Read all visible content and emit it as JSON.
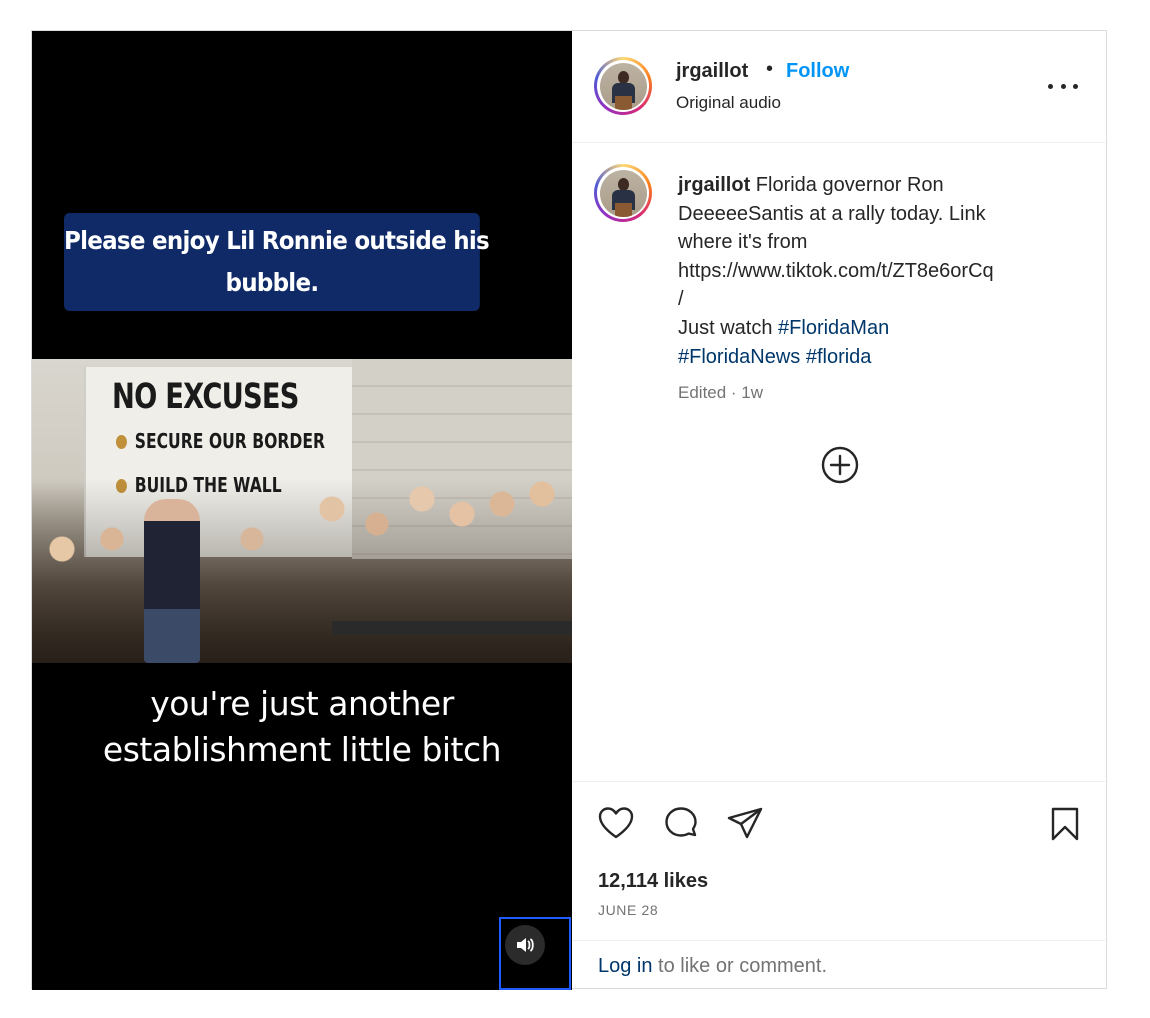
{
  "video": {
    "caption_top_lines": [
      "Please enjoy Lil Ronnie outside his",
      "bubble."
    ],
    "banner_heading": "NO EXCUSES",
    "banner_lines": [
      "SECURE OUR BORDER",
      "BUILD THE WALL"
    ],
    "caption_bottom_lines": [
      "you're just another",
      "establishment little bitch"
    ]
  },
  "header": {
    "username": "jrgaillot",
    "separator": "•",
    "follow_label": "Follow",
    "audio_label": "Original audio"
  },
  "caption": {
    "username": "jrgaillot",
    "lines": [
      "Florida governor Ron",
      "DeeeeeSantis at a rally today. Link",
      "where it's from",
      "https://www.tiktok.com/t/ZT8e6orCq",
      "/"
    ],
    "last_line_prefix": "Just watch ",
    "hashtags": [
      "#FloridaMan",
      "#FloridaNews",
      "#florida"
    ],
    "meta": "Edited · 1w"
  },
  "stats": {
    "likes": "12,114 likes",
    "date": "JUNE 28"
  },
  "footer": {
    "login_link": "Log in",
    "login_rest": " to like or comment."
  },
  "icons": {
    "like": "heart-icon",
    "comment": "comment-icon",
    "share": "share-icon",
    "save": "bookmark-icon",
    "more": "more-options-icon",
    "load_more": "plus-circle-icon",
    "audio": "speaker-icon"
  },
  "colors": {
    "follow": "#0095f6",
    "hashtag": "#00376b",
    "caption_box": "#0f2a66"
  }
}
